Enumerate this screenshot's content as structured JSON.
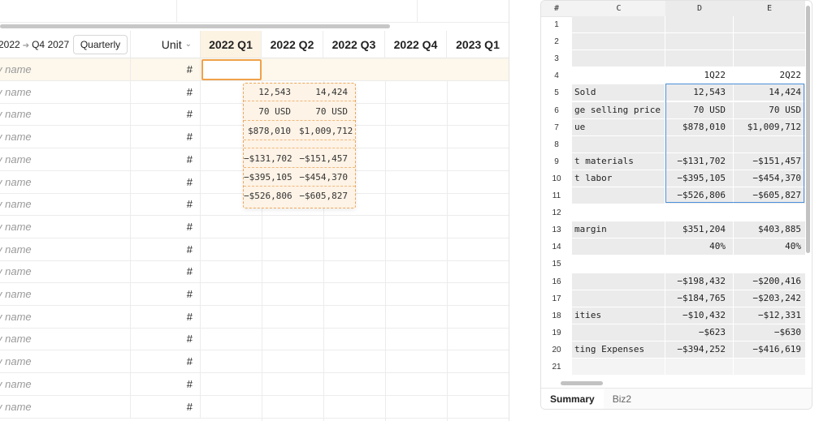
{
  "left_panel": {
    "range": {
      "start": "2022",
      "end_quarter": "Q4",
      "end_year": "2027",
      "arrow_icon": "arrow-right-icon"
    },
    "period_button": "Quarterly",
    "unit_header": "Unit",
    "quarter_headers": [
      "2022 Q1",
      "2022 Q2",
      "2022 Q3",
      "2022 Q4",
      "2023 Q1"
    ],
    "row_placeholder": "v name",
    "row_unit": "#",
    "row_count": 16,
    "paste_preview": [
      [
        "12,543",
        "14,424"
      ],
      [
        "70 USD",
        "70 USD"
      ],
      [
        "$878,010",
        "$1,009,712"
      ],
      [
        "",
        ""
      ],
      [
        "−$131,702",
        "−$151,457"
      ],
      [
        "−$395,105",
        "−$454,370"
      ],
      [
        "−$526,806",
        "−$605,827"
      ]
    ],
    "colors": {
      "accent": "#f0a24a",
      "preview_bg": "#fdf3e6"
    }
  },
  "spreadsheet": {
    "columns": [
      "#",
      "C",
      "D",
      "E"
    ],
    "rows": [
      {
        "n": "1",
        "c": "",
        "d": "",
        "e": ""
      },
      {
        "n": "2",
        "c": "",
        "d": "",
        "e": ""
      },
      {
        "n": "3",
        "c": "",
        "d": "",
        "e": ""
      },
      {
        "n": "4",
        "c": "",
        "d": "1Q22",
        "e": "2Q22"
      },
      {
        "n": "5",
        "c": " Sold",
        "d": "12,543",
        "e": "14,424"
      },
      {
        "n": "6",
        "c": "ge selling price",
        "d": "70 USD",
        "e": "70 USD"
      },
      {
        "n": "7",
        "c": "ue",
        "d": "$878,010",
        "e": "$1,009,712"
      },
      {
        "n": "8",
        "c": "",
        "d": "",
        "e": ""
      },
      {
        "n": "9",
        "c": "t materials",
        "d": "−$131,702",
        "e": "−$151,457"
      },
      {
        "n": "10",
        "c": "t labor",
        "d": "−$395,105",
        "e": "−$454,370"
      },
      {
        "n": "11",
        "c": "",
        "d": "−$526,806",
        "e": "−$605,827"
      },
      {
        "n": "12",
        "c": "",
        "d": "",
        "e": ""
      },
      {
        "n": "13",
        "c": " margin",
        "d": "$351,204",
        "e": "$403,885"
      },
      {
        "n": "14",
        "c": "",
        "d": "40%",
        "e": "40%"
      },
      {
        "n": "15",
        "c": "",
        "d": "",
        "e": ""
      },
      {
        "n": "16",
        "c": "",
        "d": "−$198,432",
        "e": "−$200,416"
      },
      {
        "n": "17",
        "c": "",
        "d": "−$184,765",
        "e": "−$203,242"
      },
      {
        "n": "18",
        "c": "ities",
        "d": "−$10,432",
        "e": "−$12,331"
      },
      {
        "n": "19",
        "c": "",
        "d": "−$623",
        "e": "−$630"
      },
      {
        "n": "20",
        "c": "ting Expenses",
        "d": "−$394,252",
        "e": "−$416,619"
      },
      {
        "n": "21",
        "c": "",
        "d": "",
        "e": ""
      }
    ],
    "tabs": [
      "Summary",
      "Biz2"
    ],
    "active_tab": "Summary",
    "colors": {
      "selection": "#4b8fd9",
      "cell_shade": "#ebebeb"
    }
  }
}
